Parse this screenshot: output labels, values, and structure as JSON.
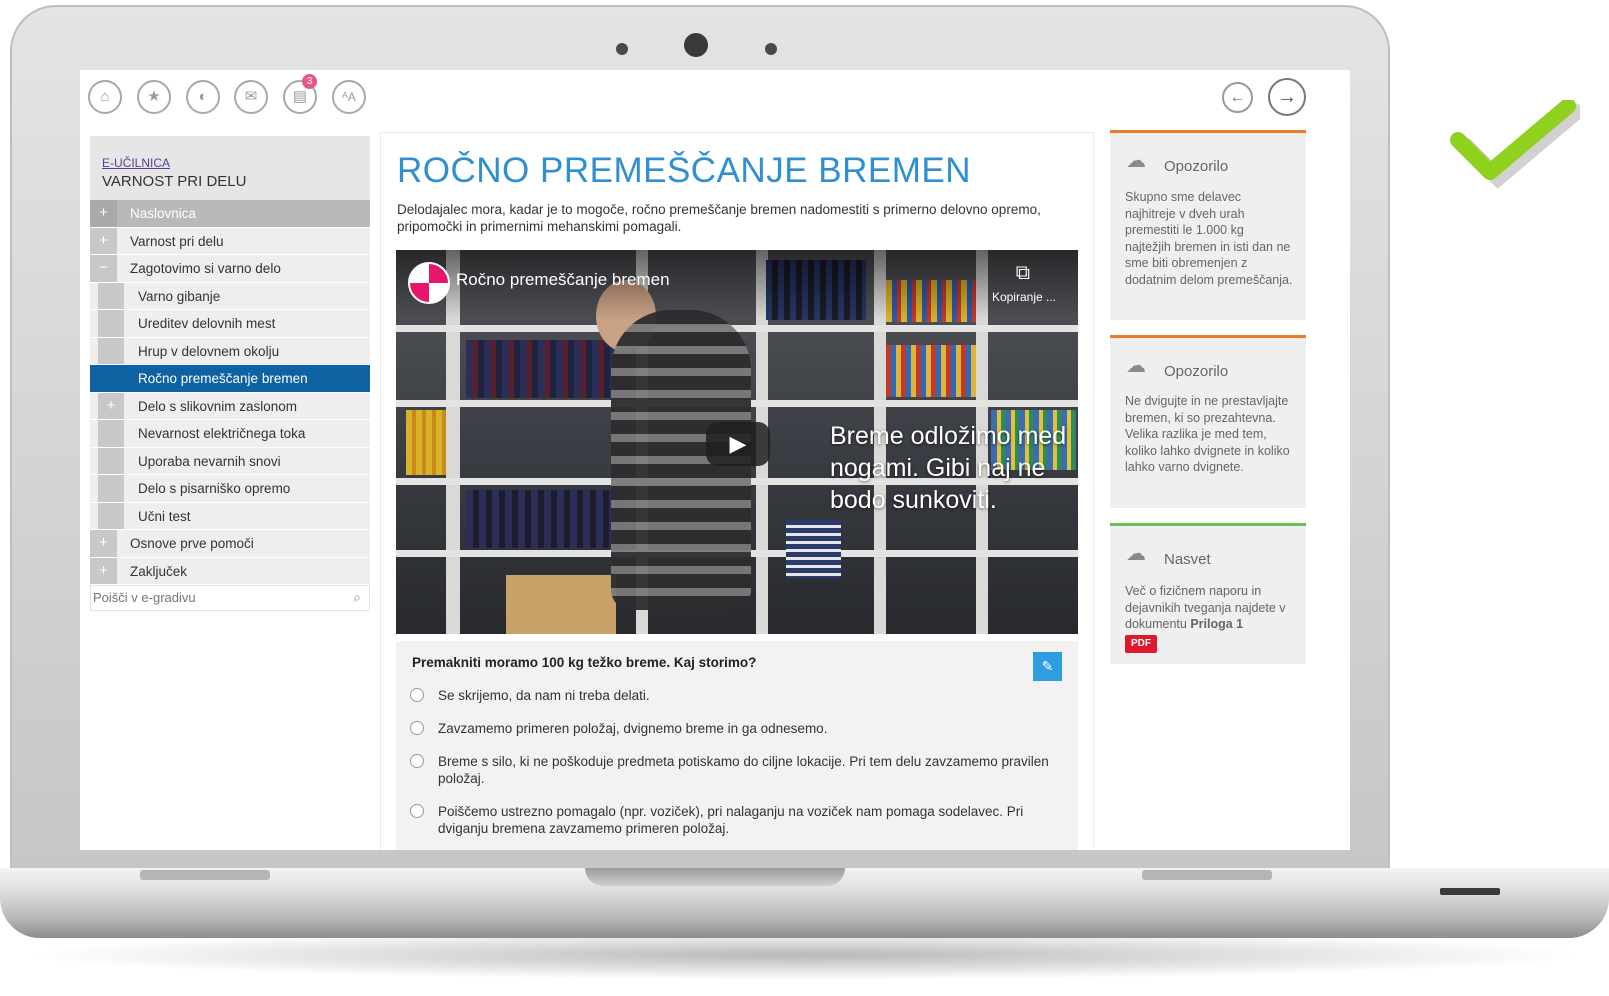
{
  "toolbar": {
    "buttons": [
      {
        "name": "home-icon",
        "glyph": "⌂"
      },
      {
        "name": "star-icon",
        "glyph": "★"
      },
      {
        "name": "contrast-icon",
        "glyph": "◐"
      },
      {
        "name": "inbox-icon",
        "glyph": "✉"
      },
      {
        "name": "notes-icon",
        "glyph": "▤"
      },
      {
        "name": "font-size-icon",
        "glyph": "ᴬA"
      }
    ],
    "notes_badge": "3",
    "back_glyph": "←",
    "forward_glyph": "→"
  },
  "sidebar": {
    "crumb": "E-UČILNICA",
    "title": "VARNOST PRI DELU",
    "items": [
      {
        "label": "Naslovnica",
        "marker": "+",
        "level": 0,
        "state": "first"
      },
      {
        "label": "Varnost pri delu",
        "marker": "+",
        "level": 0,
        "state": ""
      },
      {
        "label": "Zagotovimo si varno delo",
        "marker": "−",
        "level": 0,
        "state": ""
      },
      {
        "label": "Varno gibanje",
        "marker": "",
        "level": 1,
        "state": ""
      },
      {
        "label": "Ureditev delovnih mest",
        "marker": "",
        "level": 1,
        "state": ""
      },
      {
        "label": "Hrup v delovnem okolju",
        "marker": "",
        "level": 1,
        "state": ""
      },
      {
        "label": "Ročno premeščanje bremen",
        "marker": "",
        "level": 1,
        "state": "active"
      },
      {
        "label": "Delo s slikovnim zaslonom",
        "marker": "+",
        "level": 1,
        "state": ""
      },
      {
        "label": "Nevarnost električnega toka",
        "marker": "",
        "level": 1,
        "state": ""
      },
      {
        "label": "Uporaba nevarnih snovi",
        "marker": "",
        "level": 1,
        "state": ""
      },
      {
        "label": "Delo s pisarniško opremo",
        "marker": "",
        "level": 1,
        "state": ""
      },
      {
        "label": "Učni test",
        "marker": "",
        "level": 1,
        "state": ""
      },
      {
        "label": "Osnove prve pomoči",
        "marker": "+",
        "level": 0,
        "state": ""
      },
      {
        "label": "Zaključek",
        "marker": "+",
        "level": 0,
        "state": ""
      }
    ],
    "search_placeholder": "Poišči v e-gradivu"
  },
  "main": {
    "title": "ROČNO PREMEŠČANJE BREMEN",
    "intro": "Delodajalec mora, kadar je to mogoče, ročno premeščanje bremen nadomestiti s primerno delovno opremo, pripomočki in primernimi mehanskimi pomagali.",
    "video": {
      "title": "Ročno premeščanje bremen",
      "copy_label": "Kopiranje ...",
      "caption": "Breme odložimo med nogami. Gibi naj ne bodo sunkoviti."
    },
    "quiz": {
      "question": "Premakniti moramo 100 kg težko breme. Kaj storimo?",
      "options": [
        "Se skrijemo, da nam ni treba delati.",
        "Zavzamemo primeren položaj, dvignemo breme in ga odnesemo.",
        "Breme s silo, ki ne poškoduje predmeta potiskamo do ciljne lokacije. Pri tem delu zavzamemo pravilen položaj.",
        "Poiščemo ustrezno pomagalo (npr. voziček), pri nalaganju na voziček nam pomaga sodelavec. Pri dviganju bremena zavzamemo primeren položaj."
      ]
    }
  },
  "right_panel": [
    {
      "title": "Opozorilo",
      "accent": "#ee7a2e",
      "body": "Skupno sme delavec najhitreje v dveh urah premestiti le 1.000 kg najtežjih bremen in isti dan ne sme biti obremenjen z dodatnim delom premeščanja."
    },
    {
      "title": "Opozorilo",
      "accent": "#ee7a2e",
      "body": "Ne dvigujte in ne prestavljajte bremen, ki so prezahtevna. Velika razlika je med tem, koliko lahko dvignete in koliko lahko varno dvignete."
    },
    {
      "title": "Nasvet",
      "accent": "#6cbf4a",
      "body_prefix": "Več o fizičnem naporu in dejavnikih tveganja najdete v dokumentu ",
      "body_bold": "Priloga 1",
      "pdf_label": "PDF"
    }
  ],
  "colors": {
    "title_blue": "#2f8fd0",
    "active_nav": "#0e62a2",
    "check_green": "#8fd11e"
  }
}
